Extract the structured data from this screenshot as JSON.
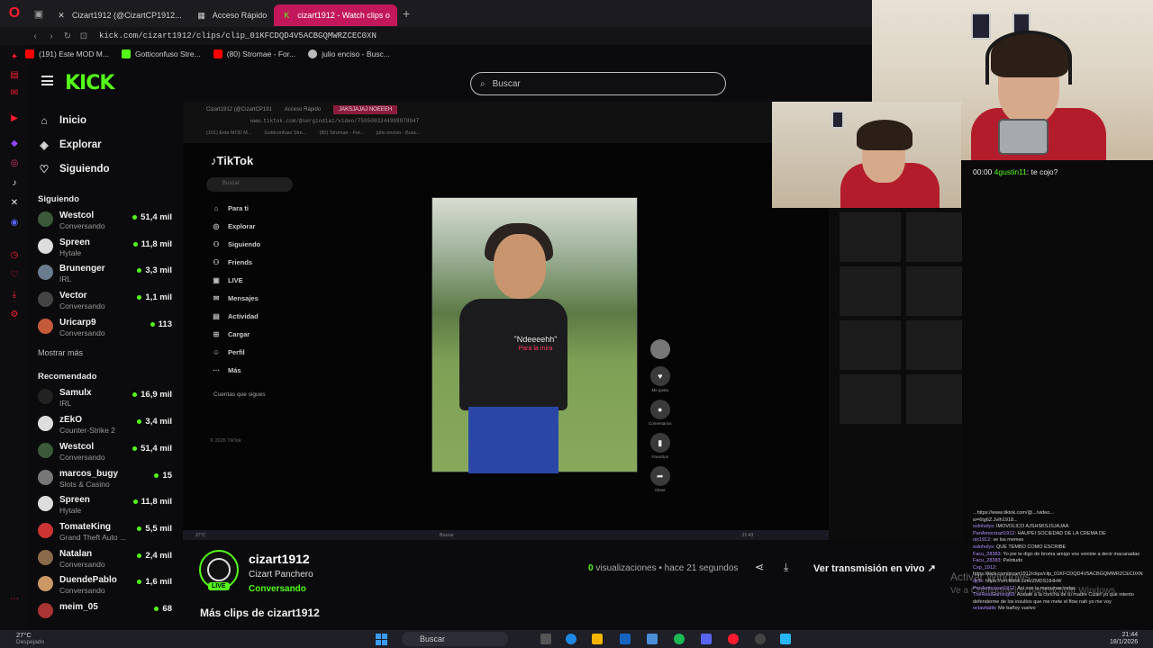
{
  "browser": {
    "tabs": [
      {
        "label": "Cizart1912 (@CizartCP1912...",
        "active": false
      },
      {
        "label": "Acceso Rápido",
        "active": false
      },
      {
        "label": "cizart1912 - Watch clips o",
        "active": true
      }
    ],
    "url": "kick.com/cizart1912/clips/clip_01KFCDQD4V5ACBGQMWRZCEC0XN",
    "bookmarks": [
      {
        "label": "(191) Este MOD M...",
        "color": "#ff0000"
      },
      {
        "label": "Gotticonfuso Stre...",
        "color": "#53fc18"
      },
      {
        "label": "(80) Stromae - For...",
        "color": "#ff0000"
      },
      {
        "label": "julio enciso - Busc...",
        "color": "#bbbbbb"
      }
    ]
  },
  "header": {
    "logo": "KICK",
    "search_placeholder": "Buscar"
  },
  "sidebar": {
    "nav": [
      {
        "label": "Inicio",
        "icon": "home-icon",
        "glyph": "⌂"
      },
      {
        "label": "Explorar",
        "icon": "compass-icon",
        "glyph": "◈"
      },
      {
        "label": "Siguiendo",
        "icon": "heart-icon",
        "glyph": "♡"
      }
    ],
    "following_title": "Siguiendo",
    "following": [
      {
        "name": "Westcol",
        "sub": "Conversando",
        "viewers": "51,4 mil",
        "color": "#3a5a3a"
      },
      {
        "name": "Spreen",
        "sub": "Hytale",
        "viewers": "11,8 mil",
        "color": "#ddd"
      },
      {
        "name": "Brunenger",
        "sub": "IRL",
        "viewers": "3,3 mil",
        "color": "#6a7c8e"
      },
      {
        "name": "Vector",
        "sub": "Conversando",
        "viewers": "1,1 mil",
        "color": "#444"
      },
      {
        "name": "Uricarp9",
        "sub": "Conversando",
        "viewers": "113",
        "color": "#c45a3a"
      }
    ],
    "show_more": "Mostrar más",
    "recommended_title": "Recomendado",
    "recommended": [
      {
        "name": "Samulx",
        "sub": "IRL",
        "viewers": "16,9 mil",
        "color": "#222"
      },
      {
        "name": "zEkO",
        "sub": "Counter-Strike 2",
        "viewers": "3,4 mil",
        "color": "#ddd"
      },
      {
        "name": "Westcol",
        "sub": "Conversando",
        "viewers": "51,4 mil",
        "color": "#3a5a3a"
      },
      {
        "name": "marcos_bugy",
        "sub": "Slots & Casino",
        "viewers": "15",
        "color": "#777"
      },
      {
        "name": "Spreen",
        "sub": "Hytale",
        "viewers": "11,8 mil",
        "color": "#ddd"
      },
      {
        "name": "TomateKing",
        "sub": "Grand Theft Auto ...",
        "viewers": "5,5 mil",
        "color": "#c33"
      },
      {
        "name": "Natalan",
        "sub": "Conversando",
        "viewers": "2,4 mil",
        "color": "#8a6a4a"
      },
      {
        "name": "DuendePablo",
        "sub": "Conversando",
        "viewers": "1,6 mil",
        "color": "#c96"
      },
      {
        "name": "meim_05",
        "sub": "",
        "viewers": "68",
        "color": "#a33"
      }
    ]
  },
  "video": {
    "inner_tabs": [
      "Cizart1912 (@CizartCP191",
      "Acceso Rápido",
      "JAKSJAJAJ NOEEEH"
    ],
    "inner_url": "www.tiktok.com/@sergiodiaz/video/7595093244999978947",
    "inner_bookmarks": [
      "(191) Este MOD M...",
      "Gotticonfuso Stre...",
      "(80) Stromae - For...",
      "julio enciso - Busc..."
    ],
    "tiktok": {
      "logo": "TikTok",
      "search": "Buscar",
      "menu": [
        {
          "label": "Para ti",
          "glyph": "⌂"
        },
        {
          "label": "Explorar",
          "glyph": "◎"
        },
        {
          "label": "Siguiendo",
          "glyph": "⚇"
        },
        {
          "label": "Friends",
          "glyph": "⚇"
        },
        {
          "label": "LIVE",
          "glyph": "▣"
        },
        {
          "label": "Mensajes",
          "glyph": "✉"
        },
        {
          "label": "Actividad",
          "glyph": "▤"
        },
        {
          "label": "Cargar",
          "glyph": "⊞"
        },
        {
          "label": "Perfil",
          "glyph": "☺"
        },
        {
          "label": "Más",
          "glyph": "⋯"
        }
      ],
      "follow_title": "Cuentas que sigues",
      "copyright": "© 2026 TikTok",
      "caption": "\"Ndeeeehh\"",
      "caption2": "Para la mira",
      "side_buttons": [
        {
          "glyph": "♥",
          "label": "Me gusta"
        },
        {
          "glyph": "●",
          "label": "Comentarios"
        },
        {
          "glyph": "▮",
          "label": "Favoritos"
        },
        {
          "glyph": "➦",
          "label": "Share"
        }
      ]
    },
    "inner_taskbar": {
      "weather": "27°C",
      "search": "Buscar",
      "time": "21:43"
    }
  },
  "chat": {
    "first_time": "00:00",
    "first_user": "4gustin11",
    "first_text": ": te cojo?",
    "log": [
      {
        "user": "",
        "text": "...https://www.tiktok.com/@.../video..."
      },
      {
        "user": "",
        "text": "si=6tg6Z.JvIh1918..."
      },
      {
        "user": "soloholys",
        "text": ": IMOVOLICO AJSHSKSJSJAJAA"
      },
      {
        "user": "PanAmocizart1912",
        "text": ": HAUPEI SOCIEDAD DE LA CREMA DE"
      },
      {
        "user": "nix1912",
        "text": ": ve los memes"
      },
      {
        "user": "soloholys",
        "text": ": QUE TEMBO COMO ESCRIBE"
      },
      {
        "user": "Facu_28383",
        "text": ": Yo pie te digo de broma amigo vos veniste a decir macanadas"
      },
      {
        "user": "Facu_28383",
        "text": ": Pelotudo"
      },
      {
        "user": "Cxp_1912",
        "text": ": https://kick.com/cizart1912/clips/clip_01KFCDQD4V5ACBGQMWRZCEC0XN"
      },
      {
        "user": "djclk",
        "text": ": https://vm.tiktok.com/ZMDS1tHH4/"
      },
      {
        "user": "PanAmocizart1912",
        "text": ": Así son la maquinas todas"
      },
      {
        "user": "TheRealGaming69",
        "text": ": Andate a la concha de tu madre Cizart yo que intento defenderme de los insultos que me mete el flow nah yo me voy"
      },
      {
        "user": "octavitabb",
        "text": ": Me bañoy vuelvo"
      }
    ]
  },
  "watermark": {
    "title": "Activar Windows",
    "sub": "Ve a Configuración para activar Windows."
  },
  "clip": {
    "streamer": "cizart1912",
    "title": "Cizart Panchero",
    "category": "Conversando",
    "live_badge": "LIVE",
    "views_num": "0",
    "views_label": "visualizaciones",
    "time_ago": "• hace 21 segundos",
    "live_link": "Ver transmisión en vivo",
    "more_clips": "Más clips de cizart1912"
  },
  "taskbar": {
    "weather_temp": "27°C",
    "weather_desc": "Despejado",
    "search": "Buscar",
    "time": "21:44",
    "date": "18/1/2026"
  }
}
